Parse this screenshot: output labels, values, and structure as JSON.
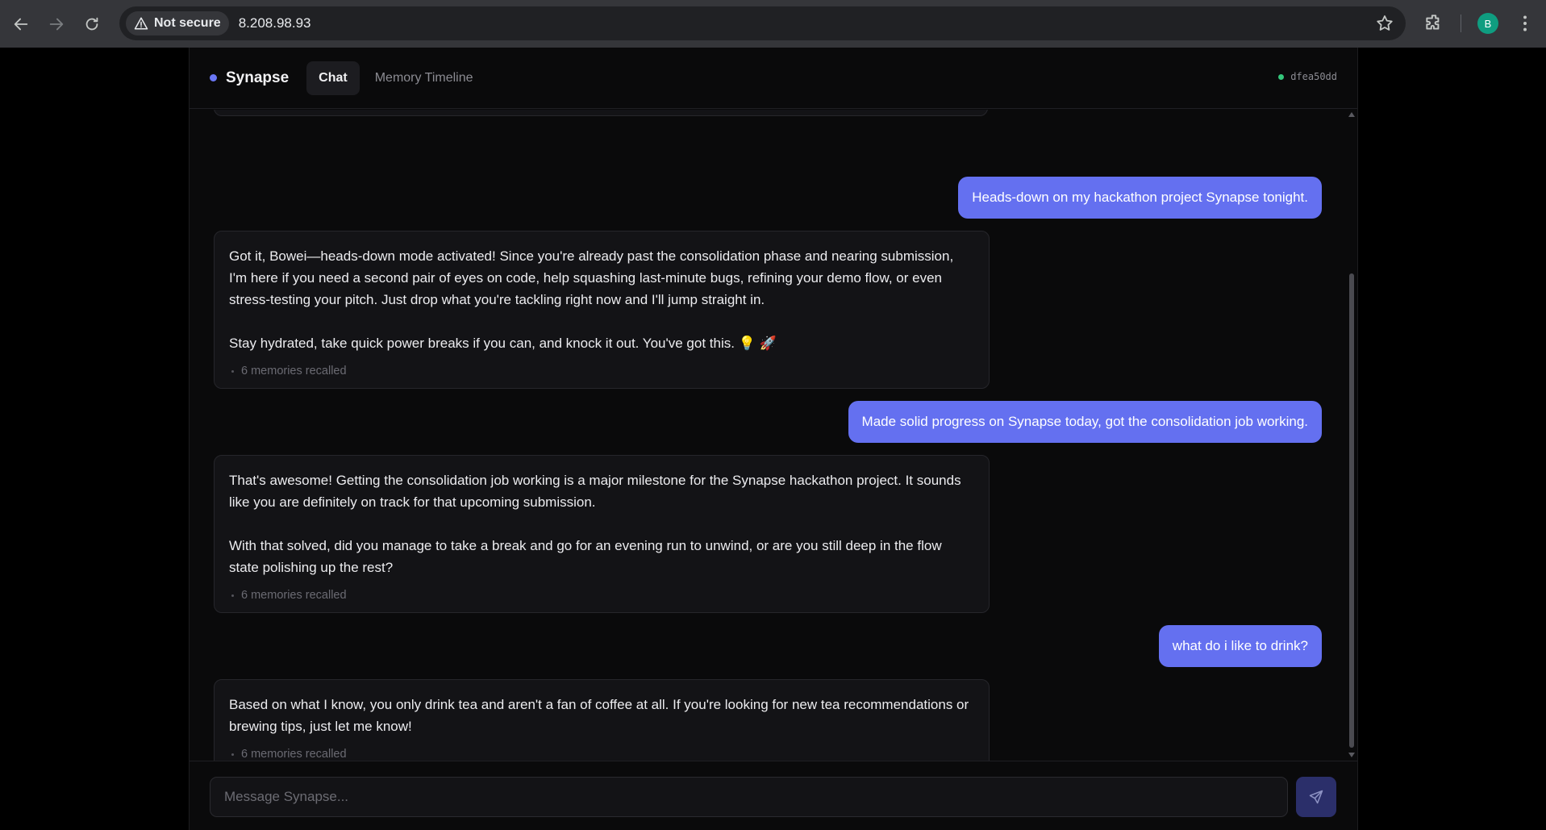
{
  "browser": {
    "security_label": "Not secure",
    "url": "8.208.98.93",
    "profile_initial": "B"
  },
  "app": {
    "brand": "Synapse",
    "tabs": [
      {
        "label": "Chat",
        "active": true
      },
      {
        "label": "Memory Timeline",
        "active": false
      }
    ],
    "session_id": "dfea50dd",
    "accent_color": "#6470f0",
    "status_color": "#34c77b"
  },
  "messages": [
    {
      "role": "user",
      "text": "Heads-down on my hackathon project Synapse tonight."
    },
    {
      "role": "assistant",
      "paragraphs": [
        "Got it, Bowei—heads-down mode activated! Since you're already past the consolidation phase and nearing submission, I'm here if you need a second pair of eyes on code, help squashing last-minute bugs, refining your demo flow, or even stress-testing your pitch. Just drop what you're tackling right now and I'll jump straight in.",
        "Stay hydrated, take quick power breaks if you can, and knock it out. You've got this. 💡 🚀"
      ],
      "recall": "6 memories recalled"
    },
    {
      "role": "user",
      "text": "Made solid progress on Synapse today, got the consolidation job working."
    },
    {
      "role": "assistant",
      "paragraphs": [
        "That's awesome! Getting the consolidation job working is a major milestone for the Synapse hackathon project. It sounds like you are definitely on track for that upcoming submission.",
        "With that solved, did you manage to take a break and go for an evening run to unwind, or are you still deep in the flow state polishing up the rest?"
      ],
      "recall": "6 memories recalled"
    },
    {
      "role": "user",
      "text": "what do i like to drink?"
    },
    {
      "role": "assistant",
      "paragraphs": [
        "Based on what I know, you only drink tea and aren't a fan of coffee at all. If you're looking for new tea recommendations or brewing tips, just let me know!"
      ],
      "recall": "6 memories recalled"
    }
  ],
  "composer": {
    "placeholder": "Message Synapse...",
    "value": ""
  }
}
